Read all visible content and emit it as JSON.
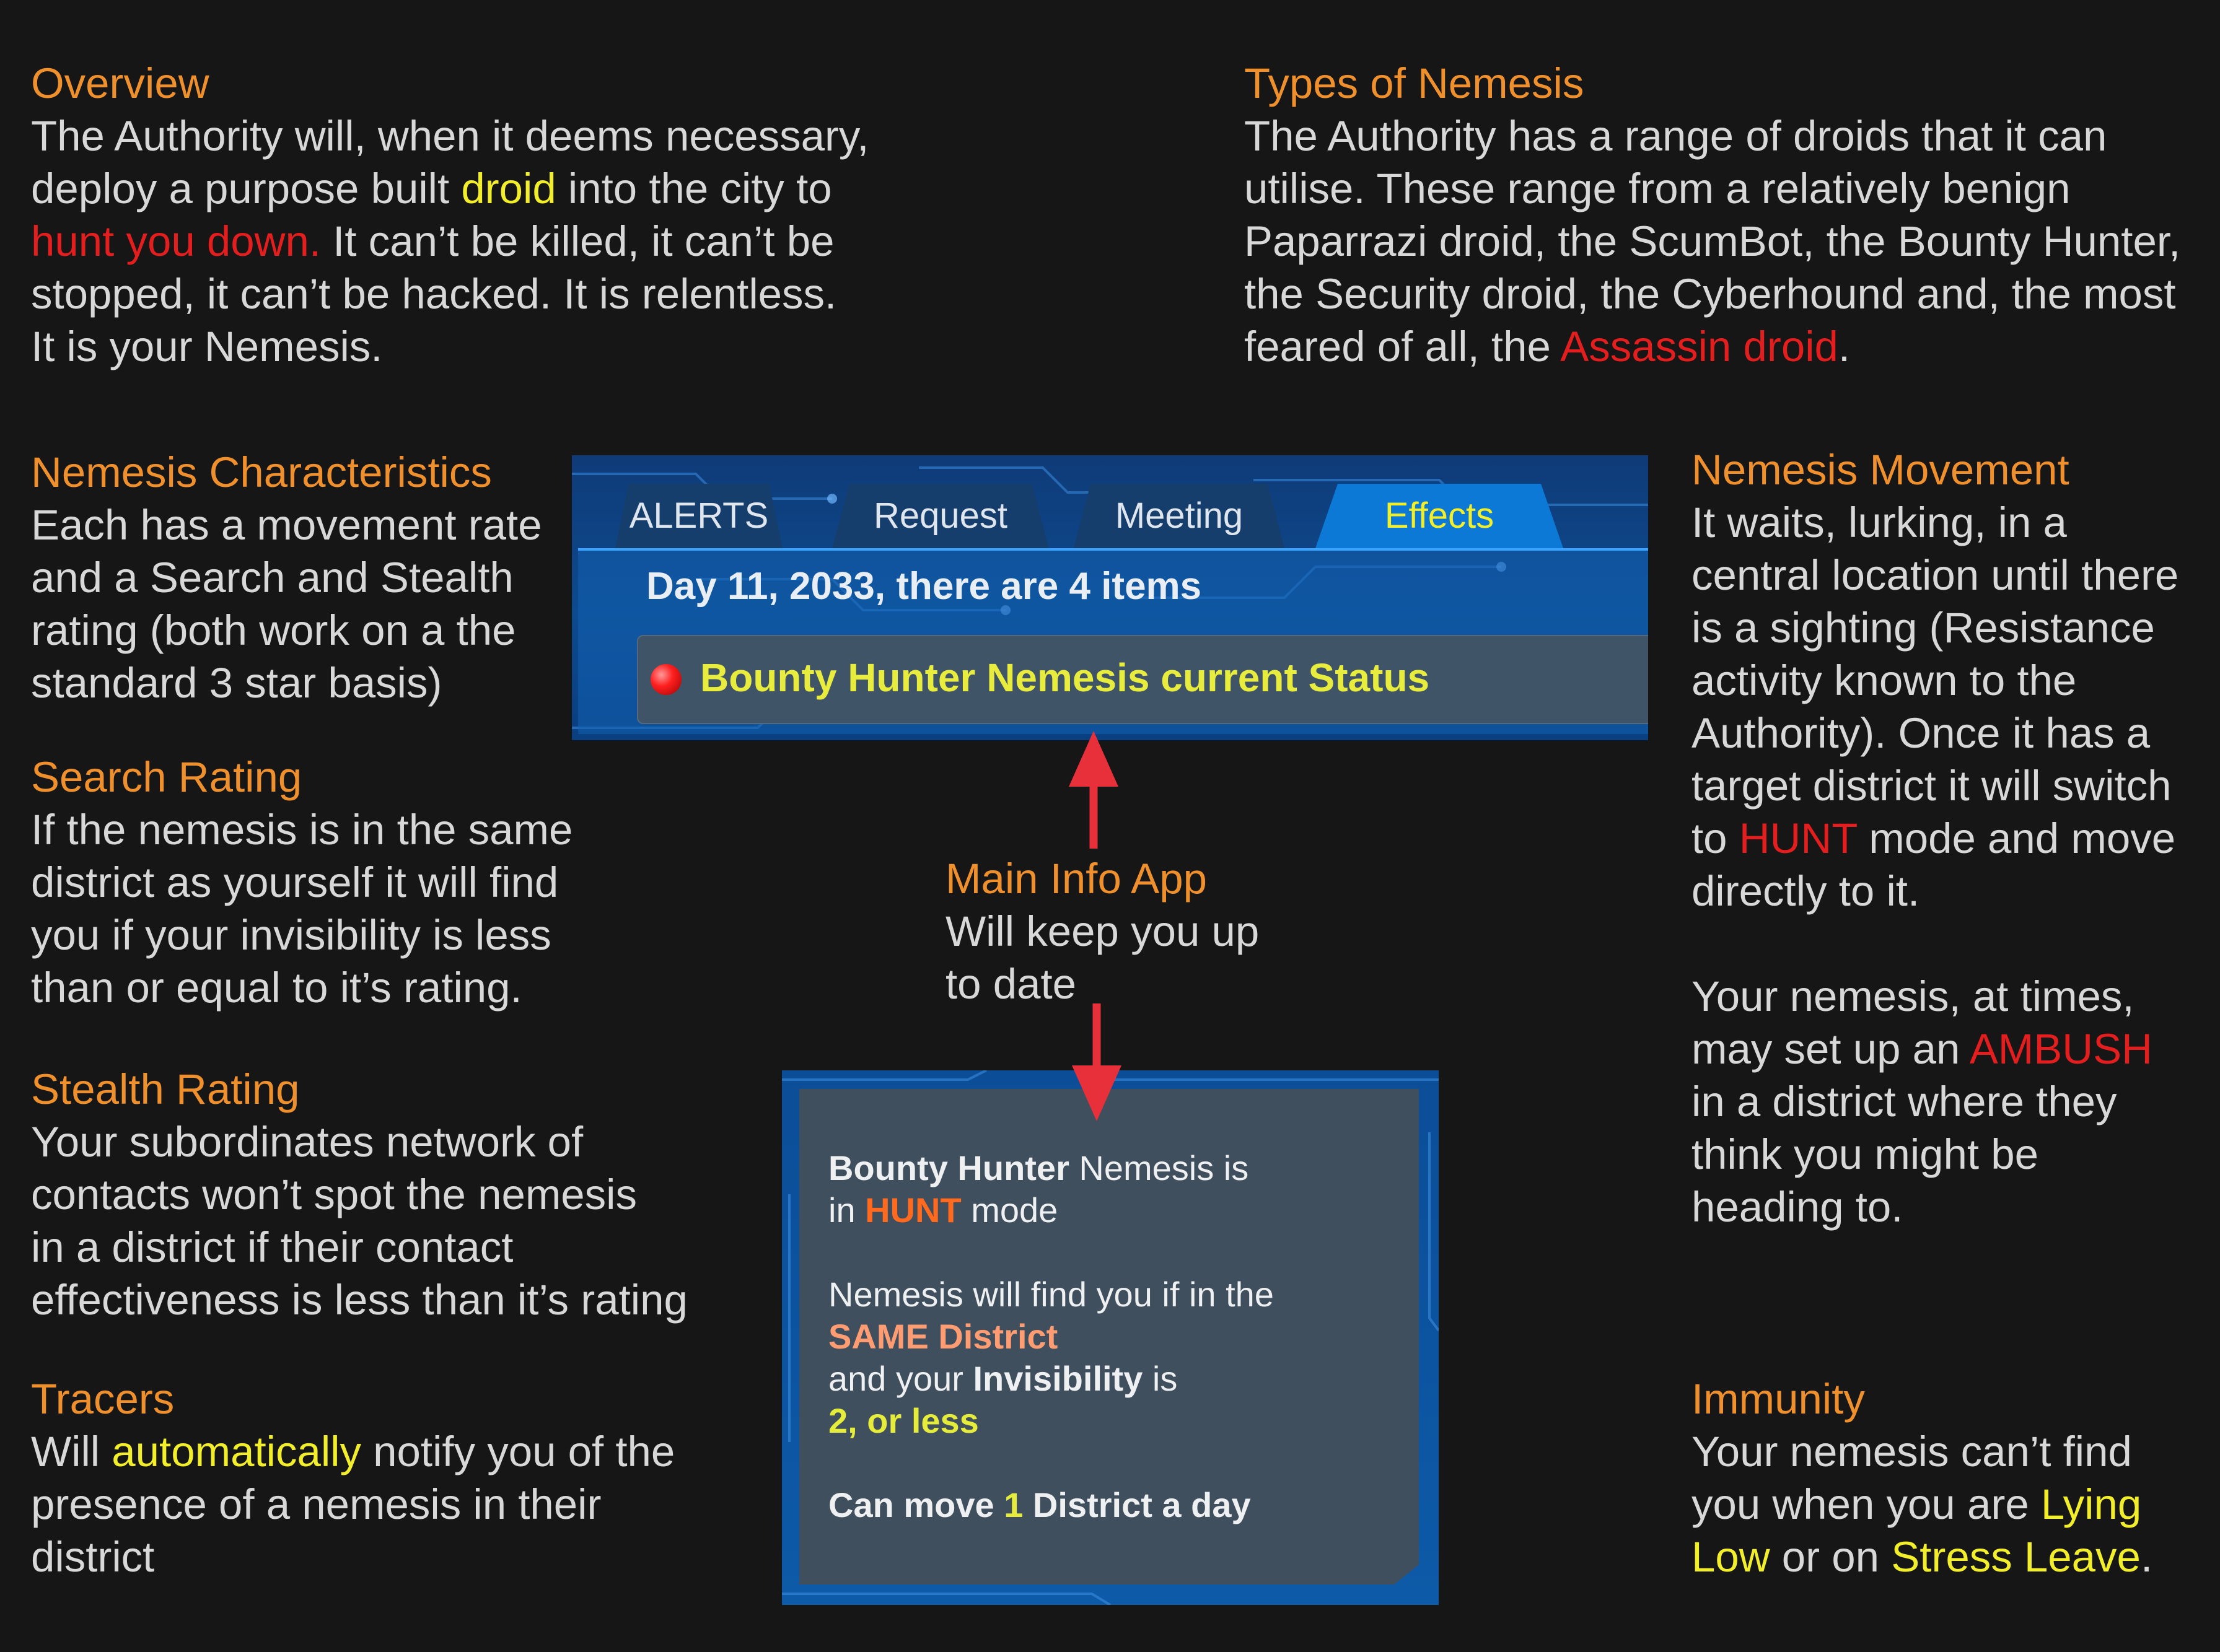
{
  "overview": {
    "heading": "Overview",
    "line1": "The Authority will, when it deems necessary,",
    "line2_a": "deploy a purpose built ",
    "line2_droid": "droid",
    "line2_b": " into the city to",
    "line3_hunt": "hunt you down.",
    "line3_b": " It can’t be killed, it can’t be",
    "line4": "stopped, it can’t be hacked. It is relentless.",
    "line5": "It is your Nemesis."
  },
  "types": {
    "heading": "Types of Nemesis",
    "line1": "The Authority has a range of droids that it can",
    "line2": "utilise. These range from a relatively benign",
    "line3": "Paparrazi droid, the ScumBot, the Bounty Hunter,",
    "line4": "the Security droid, the Cyberhound and, the most",
    "line5_a": "feared of all, the ",
    "line5_assassin": "Assassin droid",
    "line5_b": "."
  },
  "characteristics": {
    "heading": "Nemesis Characteristics",
    "lines": [
      "Each has a movement rate",
      "and a Search and Stealth",
      "rating (both work on a the",
      "standard 3 star basis)"
    ]
  },
  "search": {
    "heading": "Search Rating",
    "lines": [
      "If the nemesis is in the same",
      "district as yourself it will find",
      "you if your invisibility is less",
      "than or equal to it’s rating."
    ]
  },
  "stealth": {
    "heading": "Stealth Rating",
    "lines": [
      "Your subordinates network of",
      "contacts won’t spot the nemesis",
      "in a district if their contact",
      "effectiveness is less than it’s rating"
    ]
  },
  "tracers": {
    "heading": "Tracers",
    "line1_a": "Will ",
    "line1_auto": "automatically",
    "line1_b": " notify you of the",
    "line2": "presence of a nemesis in their",
    "line3": "district"
  },
  "movement": {
    "heading": "Nemesis Movement",
    "line1": "It waits, lurking, in  a",
    "line2": "central location until there",
    "line3": "is a sighting (Resistance",
    "line4": "activity known to the",
    "line5": "Authority). Once it has a",
    "line6": "target district it will switch",
    "line7_a": "to ",
    "line7_hunt": "HUNT",
    "line7_b": " mode and move",
    "line8": "directly to it.",
    "line9": "Your nemesis, at times,",
    "line10_a": "may set up an  ",
    "line10_ambush": "AMBUSH",
    "line11": "in a district where they",
    "line12": "think you might be",
    "line13": "heading to."
  },
  "immunity": {
    "heading": "Immunity",
    "line1": "Your nemesis can’t find",
    "line2_a": "you when you are ",
    "line2_lying": "Lying",
    "line3_low": "Low",
    "line3_b": " or on ",
    "line3_stress": "Stress Leave",
    "line3_c": "."
  },
  "main_info": {
    "heading": "Main Info App",
    "line1": "Will keep you up",
    "line2": "to date"
  },
  "app_panel": {
    "tabs": [
      "ALERTS",
      "Request",
      "Meeting",
      "Effects"
    ],
    "active_tab": "Effects",
    "date_line": "Day 11, 2033, there are 4 items",
    "status_item": "Bounty Hunter Nemesis current Status"
  },
  "status_card": {
    "l1_a": "Bounty Hunter",
    "l1_b": " Nemesis is",
    "l2_a": "in ",
    "l2_hunt": "HUNT",
    "l2_b": " mode",
    "l3": "Nemesis will find you if in the",
    "l4": "SAME District",
    "l5_a": "and your ",
    "l5_b": "Invisibility",
    "l5_c": " is",
    "l6": "2, or less",
    "l7_a": "Can move ",
    "l7_num": "1",
    "l7_b": " District a day"
  },
  "colors": {
    "background": "#161616",
    "heading": "#f0902c",
    "highlight_yellow": "#f2ee2a",
    "highlight_red": "#e41e1e",
    "arrow": "#e8303a"
  }
}
